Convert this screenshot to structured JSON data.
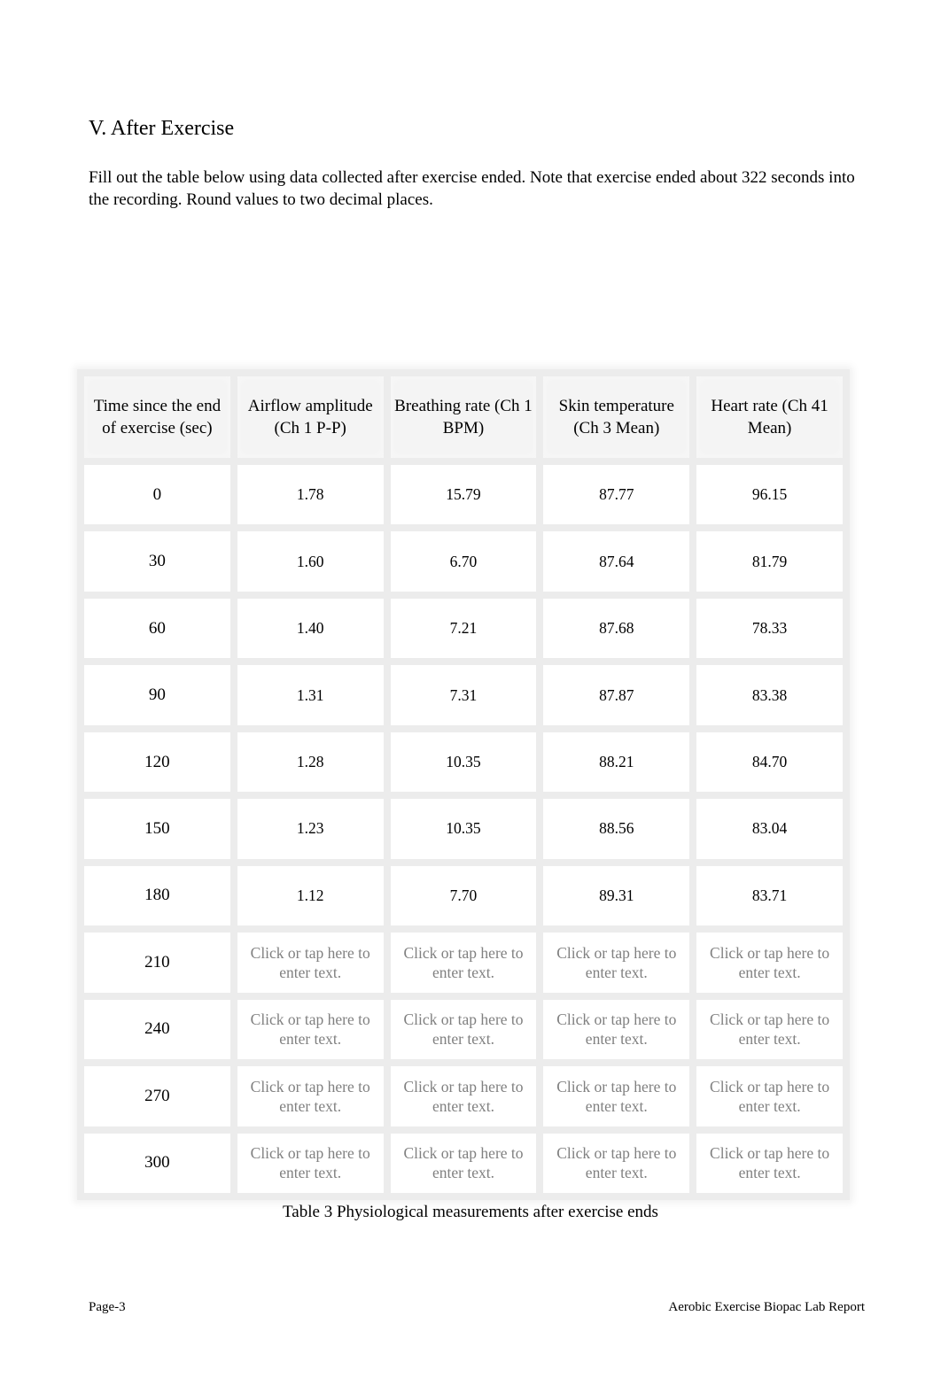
{
  "section": {
    "heading": "V. After Exercise",
    "intro": "Fill out the table below using data collected after exercise ended. Note that exercise ended about 322 seconds into the recording. Round values to two decimal places."
  },
  "table": {
    "headers": [
      "Time since the end of exercise (sec)",
      "Airflow amplitude (Ch 1 P-P)",
      "Breathing rate (Ch 1 BPM)",
      "Skin temperature (Ch 3 Mean)",
      "Heart rate (Ch 41 Mean)"
    ],
    "placeholder": "Click or tap here to enter text.",
    "rows": [
      {
        "time": "0",
        "airflow": "1.78",
        "breathing": "15.79",
        "skin_temp": "87.77",
        "heart_rate": "96.15"
      },
      {
        "time": "30",
        "airflow": "1.60",
        "breathing": "6.70",
        "skin_temp": "87.64",
        "heart_rate": "81.79"
      },
      {
        "time": "60",
        "airflow": "1.40",
        "breathing": "7.21",
        "skin_temp": "87.68",
        "heart_rate": "78.33"
      },
      {
        "time": "90",
        "airflow": "1.31",
        "breathing": "7.31",
        "skin_temp": "87.87",
        "heart_rate": "83.38"
      },
      {
        "time": "120",
        "airflow": "1.28",
        "breathing": "10.35",
        "skin_temp": "88.21",
        "heart_rate": "84.70"
      },
      {
        "time": "150",
        "airflow": "1.23",
        "breathing": "10.35",
        "skin_temp": "88.56",
        "heart_rate": "83.04"
      },
      {
        "time": "180",
        "airflow": "1.12",
        "breathing": "7.70",
        "skin_temp": "89.31",
        "heart_rate": "83.71"
      },
      {
        "time": "210",
        "airflow": null,
        "breathing": null,
        "skin_temp": null,
        "heart_rate": null
      },
      {
        "time": "240",
        "airflow": null,
        "breathing": null,
        "skin_temp": null,
        "heart_rate": null
      },
      {
        "time": "270",
        "airflow": null,
        "breathing": null,
        "skin_temp": null,
        "heart_rate": null
      },
      {
        "time": "300",
        "airflow": null,
        "breathing": null,
        "skin_temp": null,
        "heart_rate": null
      }
    ],
    "caption": "Table 3 Physiological measurements after exercise ends"
  },
  "footer": {
    "page": "Page-3",
    "title": "Aerobic Exercise Biopac Lab Report"
  }
}
